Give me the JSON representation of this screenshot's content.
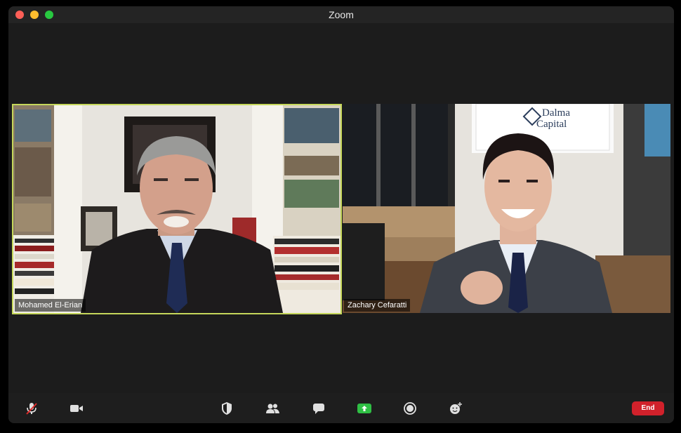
{
  "window": {
    "title": "Zoom"
  },
  "participants": [
    {
      "name": "Mohamed El-Erian",
      "active_speaker": true
    },
    {
      "name": "Zachary Cefaratti",
      "active_speaker": false
    }
  ],
  "background_sign": {
    "line1": "Dalma",
    "line2": "Capital"
  },
  "toolbar": {
    "end_label": "End",
    "icons": [
      "microphone-muted-icon",
      "video-camera-icon",
      "security-shield-icon",
      "participants-icon",
      "chat-icon",
      "share-screen-icon",
      "record-icon",
      "reactions-icon"
    ]
  },
  "colors": {
    "active_speaker_border": "#c5d75a",
    "end_button": "#d1212b",
    "share_button": "#2fbf44"
  }
}
